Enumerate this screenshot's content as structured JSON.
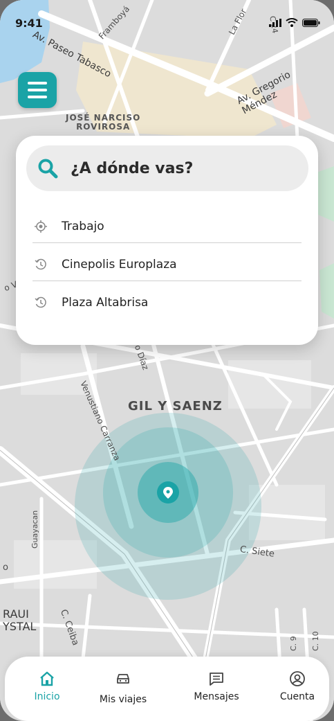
{
  "status_bar": {
    "time": "9:41"
  },
  "map": {
    "street_labels": {
      "paseo_tabasco": "Av. Paseo Tabasco",
      "gregorio_mendez": "Av. Gregorio Méndez",
      "framboyan": "Framboyá",
      "la_flor": "La Flor",
      "c24": "C 24",
      "jose_narciso_1": "JOSÉ NARCISO",
      "jose_narciso_2": "ROVIROSA",
      "diaz": "o Díaz",
      "venustiano": "Venustiano Carranza",
      "gil_saenz": "GIL Y SAENZ",
      "guayacan": "Guayacan",
      "siete": "C. Siete",
      "ceiba": "C. Ceiba",
      "raui": "RAUI",
      "ystal": "YSTAL",
      "c9": "C. 9",
      "c10": "C. 10",
      "left_edge": "o V",
      "left_o": "o"
    },
    "accent": "#1aa3a6"
  },
  "search": {
    "placeholder": "¿A dónde vas?",
    "suggestions": [
      {
        "label": "Trabajo",
        "icon": "target-icon"
      },
      {
        "label": "Cinepolis Europlaza",
        "icon": "history-icon"
      },
      {
        "label": "Plaza Altabrisa",
        "icon": "history-icon"
      }
    ]
  },
  "nav": {
    "items": [
      {
        "label": "Inicio",
        "icon": "home-icon",
        "active": true
      },
      {
        "label": "Mis viajes",
        "icon": "car-icon",
        "active": false
      },
      {
        "label": "Mensajes",
        "icon": "message-icon",
        "active": false
      },
      {
        "label": "Cuenta",
        "icon": "account-icon",
        "active": false
      }
    ]
  }
}
